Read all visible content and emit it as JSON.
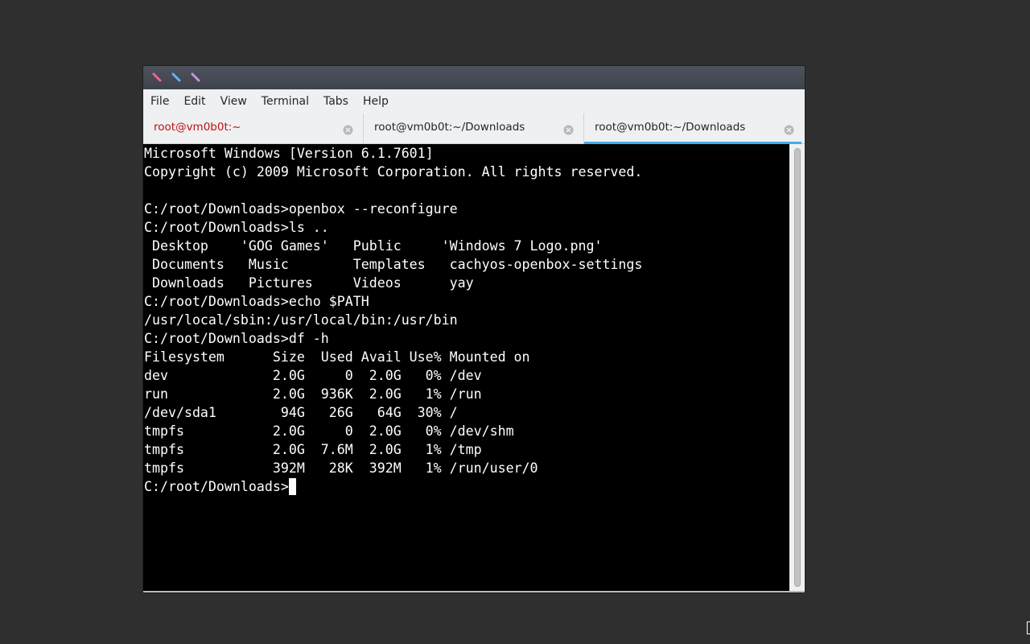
{
  "window": {
    "colors": {
      "close": "#f06292",
      "maximize": "#64b5f6",
      "minimize": "#ce93d8",
      "accent": "#3daee9"
    }
  },
  "menubar": {
    "items": [
      {
        "label": "File"
      },
      {
        "label": "Edit"
      },
      {
        "label": "View"
      },
      {
        "label": "Terminal"
      },
      {
        "label": "Tabs"
      },
      {
        "label": "Help"
      }
    ]
  },
  "tabs": [
    {
      "label": "root@vm0b0t:~",
      "state": "alert"
    },
    {
      "label": "root@vm0b0t:~/Downloads",
      "state": "normal"
    },
    {
      "label": "root@vm0b0t:~/Downloads",
      "state": "active"
    }
  ],
  "terminal": {
    "lines": [
      "Microsoft Windows [Version 6.1.7601]",
      "Copyright (c) 2009 Microsoft Corporation. All rights reserved.",
      "",
      "C:/root/Downloads>openbox --reconfigure",
      "C:/root/Downloads>ls ..",
      " Desktop    'GOG Games'   Public     'Windows 7 Logo.png'",
      " Documents   Music        Templates   cachyos-openbox-settings",
      " Downloads   Pictures     Videos      yay",
      "C:/root/Downloads>echo $PATH",
      "/usr/local/sbin:/usr/local/bin:/usr/bin",
      "C:/root/Downloads>df -h",
      "Filesystem      Size  Used Avail Use% Mounted on",
      "dev             2.0G     0  2.0G   0% /dev",
      "run             2.0G  936K  2.0G   1% /run",
      "/dev/sda1        94G   26G   64G  30% /",
      "tmpfs           2.0G     0  2.0G   0% /dev/shm",
      "tmpfs           2.0G  7.6M  2.0G   1% /tmp",
      "tmpfs           392M   28K  392M   1% /run/user/0"
    ],
    "prompt": "C:/root/Downloads>"
  }
}
